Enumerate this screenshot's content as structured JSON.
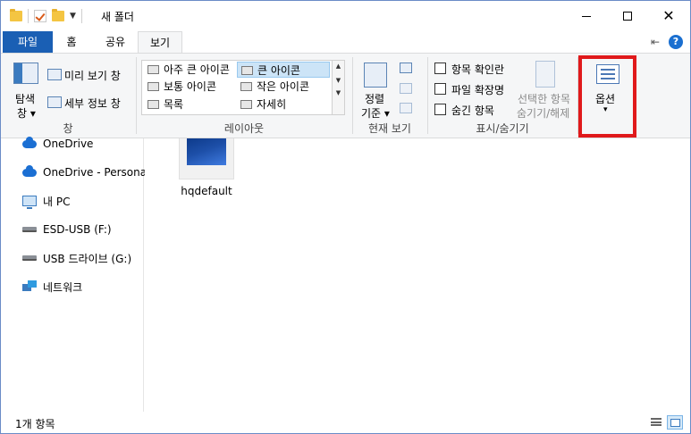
{
  "window": {
    "title": "새 폴더"
  },
  "tabs": {
    "file": "파일",
    "home": "홈",
    "share": "공유",
    "view": "보기"
  },
  "ribbon": {
    "pane": {
      "nav_pane_top": "탐색",
      "nav_pane_bottom": "창",
      "preview": "미리 보기 창",
      "details": "세부 정보 창",
      "label": "창"
    },
    "layout": {
      "items": {
        "xlarge": "아주 큰 아이콘",
        "large": "큰 아이콘",
        "medium": "보통 아이콘",
        "small": "작은 아이콘",
        "list": "목록",
        "details": "자세히"
      },
      "label": "레이아웃"
    },
    "current_view": {
      "sort_top": "정렬",
      "sort_bottom": "기준",
      "label": "현재 보기"
    },
    "show_hide": {
      "item_checkboxes": "항목 확인란",
      "file_extensions": "파일 확장명",
      "hidden_items": "숨긴 항목",
      "hide_selected_top": "선택한 항목",
      "hide_selected_bottom": "숨기기/해제",
      "label": "표시/숨기기"
    },
    "options": {
      "label": "옵션"
    },
    "highlight_color": "#e0191b"
  },
  "nav": {
    "items": [
      "OneDrive",
      "OneDrive - Personal",
      "내 PC",
      "ESD-USB (F:)",
      "USB 드라이브 (G:)",
      "네트워크"
    ]
  },
  "content": {
    "file_name": "hqdefault"
  },
  "status": {
    "count": "1개 항목"
  }
}
